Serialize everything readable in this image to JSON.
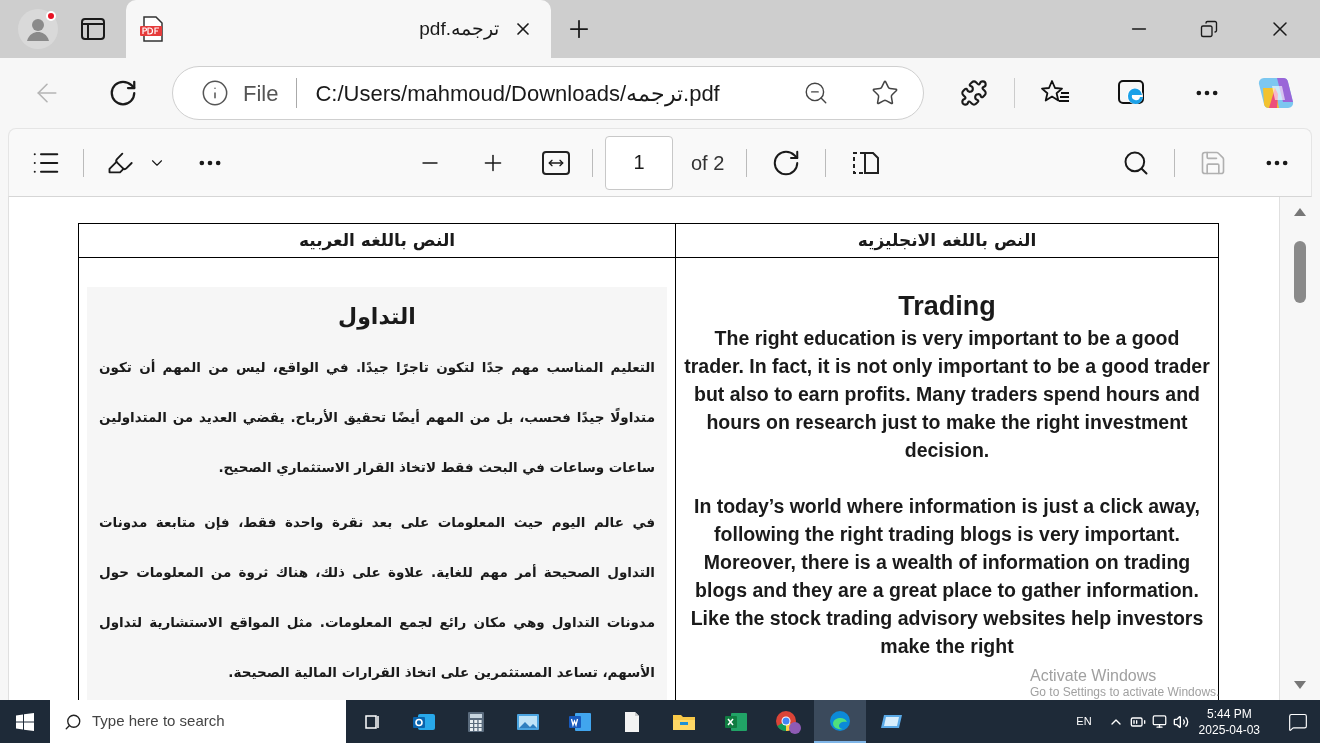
{
  "profile": {
    "notification": true
  },
  "tabs": [
    {
      "title": "ترجمه.pdf",
      "selected": true
    }
  ],
  "address": {
    "scheme": "File",
    "url": "C:/Users/mahmoud/Downloads/ترجمه.pdf"
  },
  "pdf_toolbar": {
    "page": "1",
    "page_count": "of 2"
  },
  "document": {
    "columns": [
      {
        "kind": "english",
        "header": "النص باللغه الانجليزيه",
        "title": "Trading",
        "paragraphs": [
          "The right education is very important to be a good trader. In fact, it is not only important to be a good trader but also to earn profits. Many traders spend hours and hours on research just to make the right investment decision.",
          "In today’s world where information is just a click away, following the right trading blogs is very important. Moreover, there is a wealth of information on trading blogs and they are a great place to gather information. Like the stock trading advisory websites help investors make the right"
        ]
      },
      {
        "kind": "arabic",
        "header": "النص باللغه العربيه",
        "title": "التداول",
        "paragraphs": [
          "التعليم المناسب مهم جدًا لتكون تاجرًا جيدًا. في الواقع، ليس من المهم أن تكون متداولًا جيدًا فحسب، بل من المهم أيضًا تحقيق الأرباح. يقضي العديد من المتداولين ساعات وساعات في البحث فقط لاتخاذ القرار الاستثماري الصحيح.",
          "في عالم اليوم حيث المعلومات على بعد نقرة واحدة فقط، فإن متابعة مدونات التداول الصحيحة أمر مهم للغاية. علاوة على ذلك، هناك ثروة من المعلومات حول مدونات التداول وهي مكان رائع لجمع المعلومات. مثل المواقع الاستشارية لتداول الأسهم، تساعد المستثمرين على اتخاذ القرارات المالية الصحيحة."
        ]
      }
    ]
  },
  "system_notice": {
    "title": "Activate Windows",
    "subtitle": "Go to Settings to activate Windows."
  },
  "taskbar": {
    "search_placeholder": "Type here to search",
    "apps": [
      {
        "kind": "taskview",
        "selected": false
      },
      {
        "kind": "mail",
        "selected": false
      },
      {
        "kind": "calculator",
        "selected": false
      },
      {
        "kind": "photo",
        "selected": false
      },
      {
        "kind": "word",
        "selected": false
      },
      {
        "kind": "file",
        "selected": false
      },
      {
        "kind": "folder",
        "selected": false
      },
      {
        "kind": "excel",
        "selected": false
      },
      {
        "kind": "chrome",
        "selected": false
      },
      {
        "kind": "edge",
        "selected": true
      },
      {
        "kind": "remote",
        "selected": false
      }
    ],
    "language": "EN",
    "time": "5:44 PM",
    "date": "2025-04-03"
  }
}
